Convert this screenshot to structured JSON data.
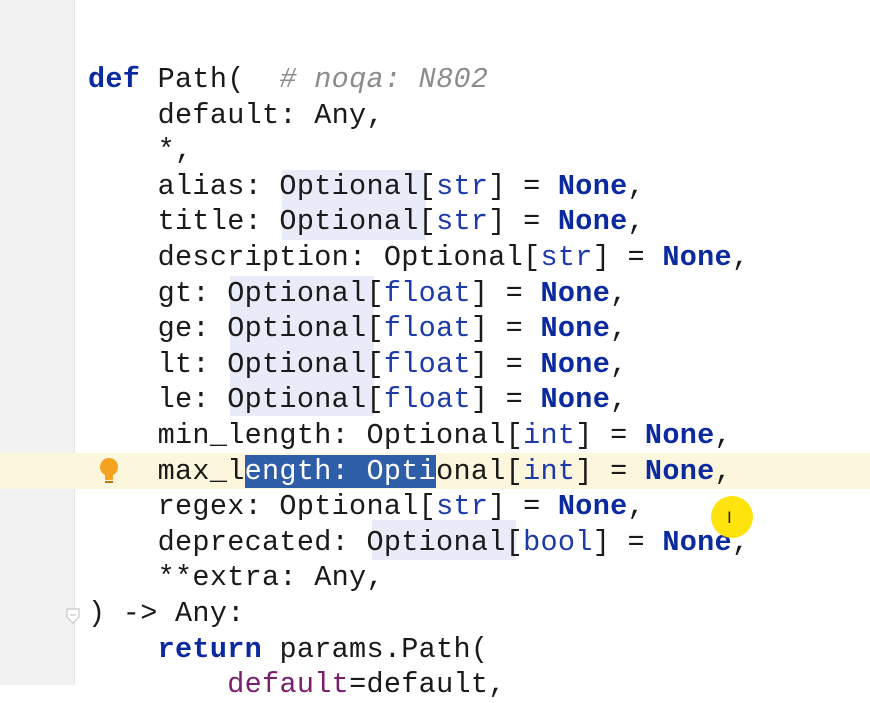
{
  "editor": {
    "language": "python",
    "lines": [
      {
        "id": "l1",
        "parts": [
          {
            "t": "def",
            "c": "kw"
          },
          {
            "t": " Path("
          },
          {
            "t": "  "
          },
          {
            "t": "# noqa: N802",
            "c": "comment"
          }
        ]
      },
      {
        "id": "l2",
        "parts": [
          {
            "t": "    default: Any,"
          }
        ]
      },
      {
        "id": "l3",
        "parts": [
          {
            "t": "    *,"
          }
        ]
      },
      {
        "id": "l4",
        "parts": [
          {
            "t": "    alias: Optional["
          },
          {
            "t": "str",
            "c": "builtin"
          },
          {
            "t": "] = "
          },
          {
            "t": "None",
            "c": "none"
          },
          {
            "t": ","
          }
        ]
      },
      {
        "id": "l5",
        "parts": [
          {
            "t": "    title: Optional["
          },
          {
            "t": "str",
            "c": "builtin"
          },
          {
            "t": "] = "
          },
          {
            "t": "None",
            "c": "none"
          },
          {
            "t": ","
          }
        ]
      },
      {
        "id": "l6",
        "parts": [
          {
            "t": "    description: Optional["
          },
          {
            "t": "str",
            "c": "builtin"
          },
          {
            "t": "] = "
          },
          {
            "t": "None",
            "c": "none"
          },
          {
            "t": ","
          }
        ]
      },
      {
        "id": "l7",
        "parts": [
          {
            "t": "    gt: Optional["
          },
          {
            "t": "float",
            "c": "builtin"
          },
          {
            "t": "] = "
          },
          {
            "t": "None",
            "c": "none"
          },
          {
            "t": ","
          }
        ]
      },
      {
        "id": "l8",
        "parts": [
          {
            "t": "    ge: Optional["
          },
          {
            "t": "float",
            "c": "builtin"
          },
          {
            "t": "] = "
          },
          {
            "t": "None",
            "c": "none"
          },
          {
            "t": ","
          }
        ]
      },
      {
        "id": "l9",
        "parts": [
          {
            "t": "    lt: Optional["
          },
          {
            "t": "float",
            "c": "builtin"
          },
          {
            "t": "] = "
          },
          {
            "t": "None",
            "c": "none"
          },
          {
            "t": ","
          }
        ]
      },
      {
        "id": "l10",
        "parts": [
          {
            "t": "    le: Optional["
          },
          {
            "t": "float",
            "c": "builtin"
          },
          {
            "t": "] = "
          },
          {
            "t": "None",
            "c": "none"
          },
          {
            "t": ","
          }
        ]
      },
      {
        "id": "l11",
        "parts": [
          {
            "t": "    min_length: Optional["
          },
          {
            "t": "int",
            "c": "builtin"
          },
          {
            "t": "] = "
          },
          {
            "t": "None",
            "c": "none"
          },
          {
            "t": ","
          }
        ]
      },
      {
        "id": "l12",
        "parts": [
          {
            "t": "    max_l"
          },
          {
            "t": "ength: Opti",
            "c": "sel"
          },
          {
            "t": "onal["
          },
          {
            "t": "int",
            "c": "builtin"
          },
          {
            "t": "] = "
          },
          {
            "t": "None",
            "c": "none"
          },
          {
            "t": ","
          }
        ]
      },
      {
        "id": "l13",
        "parts": [
          {
            "t": "    regex: Optional["
          },
          {
            "t": "str",
            "c": "builtin"
          },
          {
            "t": "] = "
          },
          {
            "t": "None",
            "c": "none"
          },
          {
            "t": ","
          }
        ]
      },
      {
        "id": "l14",
        "parts": [
          {
            "t": "    deprecated: Optional["
          },
          {
            "t": "bool",
            "c": "builtin"
          },
          {
            "t": "] = "
          },
          {
            "t": "None",
            "c": "none"
          },
          {
            "t": ","
          }
        ]
      },
      {
        "id": "l15",
        "parts": [
          {
            "t": "    **extra: Any,"
          }
        ]
      },
      {
        "id": "l16",
        "parts": [
          {
            "t": ") -> Any:"
          }
        ]
      },
      {
        "id": "l17",
        "parts": [
          {
            "t": "    "
          },
          {
            "t": "return",
            "c": "kw"
          },
          {
            "t": " params.Path("
          }
        ]
      },
      {
        "id": "l18",
        "parts": [
          {
            "t": "        "
          },
          {
            "t": "default",
            "c": "kwarg"
          },
          {
            "t": "=default,"
          }
        ]
      }
    ],
    "selection_text": "ength: Opti",
    "colors": {
      "keyword": "#0b2a9f",
      "selection": "#2f5ea8",
      "current_line": "#fcf6dc",
      "gutter": "#f2f2f2",
      "comment": "#8c8c8c"
    },
    "icons": {
      "intention": "lightbulb-icon",
      "fold": "fold-marker-icon"
    }
  }
}
